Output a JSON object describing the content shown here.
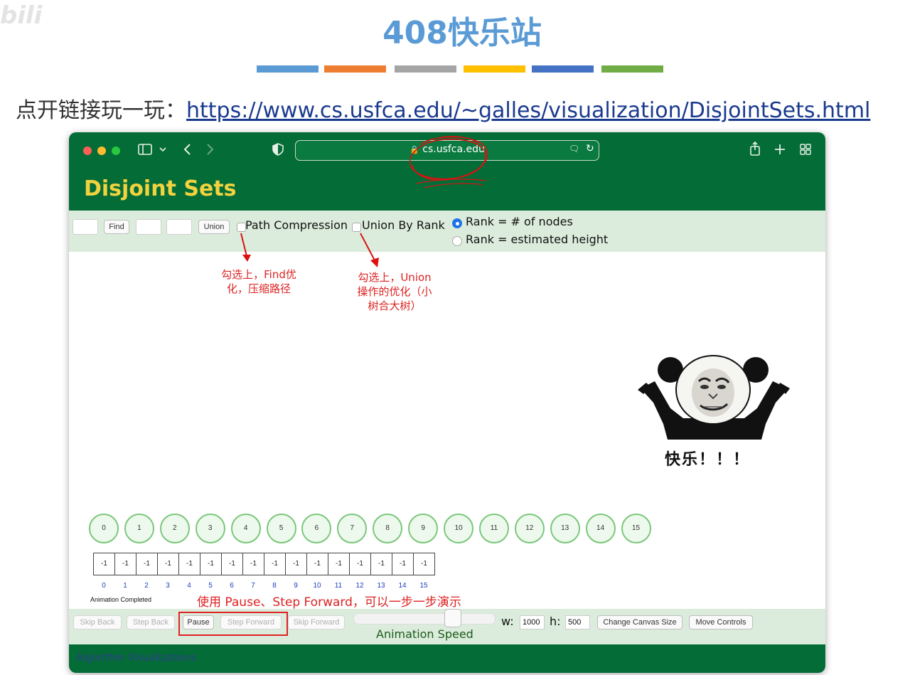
{
  "slide": {
    "title": "408快乐站",
    "strip_colors": [
      "#5b9bd5",
      "#ed7d31",
      "#a5a5a5",
      "#ffc000",
      "#4472c4",
      "#70ad47"
    ],
    "intro_label": "点开链接玩一玩：",
    "link_text": "https://www.cs.usfca.edu/~galles/visualization/DisjointSets.html",
    "watermark": "bili"
  },
  "browser": {
    "url": "cs.usfca.edu",
    "icons": [
      "sidebar-icon",
      "chevron-down-icon",
      "back-icon",
      "forward-icon",
      "shield-icon",
      "lock-icon",
      "translate-icon",
      "reload-icon",
      "share-icon",
      "new-tab-icon",
      "tab-overview-icon"
    ]
  },
  "page": {
    "title": "Disjoint Sets",
    "controls": {
      "find_label": "Find",
      "union_label": "Union",
      "path_compression_label": "Path Compression",
      "union_by_rank_label": "Union By Rank",
      "rank_nodes_label": "Rank = # of nodes",
      "rank_height_label": "Rank = estimated height",
      "selected_rank": "Rank = # of nodes"
    },
    "annotations": {
      "path_compression_line1": "勾选上，Find优",
      "path_compression_line2": "化，压缩路径",
      "union_rank_line1": "勾选上，Union",
      "union_rank_line2": "操作的优化（小",
      "union_rank_line3": "树合大树）",
      "bottom": "使用 Pause、Step Forward，可以一步一步演示"
    },
    "sticker_caption": "快乐！！！",
    "nodes": [
      "0",
      "1",
      "2",
      "3",
      "4",
      "5",
      "6",
      "7",
      "8",
      "9",
      "10",
      "11",
      "12",
      "13",
      "14",
      "15"
    ],
    "parent_array": [
      "-1",
      "-1",
      "-1",
      "-1",
      "-1",
      "-1",
      "-1",
      "-1",
      "-1",
      "-1",
      "-1",
      "-1",
      "-1",
      "-1",
      "-1",
      "-1"
    ],
    "array_indices": [
      "0",
      "1",
      "2",
      "3",
      "4",
      "5",
      "6",
      "7",
      "8",
      "9",
      "10",
      "11",
      "12",
      "13",
      "14",
      "15"
    ],
    "status": "Animation Completed",
    "bottom_controls": {
      "skip_back": "Skip Back",
      "step_back": "Step Back",
      "pause": "Pause",
      "step_forward": "Step Forward",
      "skip_forward": "Skip Forward",
      "speed_label": "Animation Speed",
      "speed_value": 0.7,
      "w_label": "w:",
      "w_value": "1000",
      "h_label": "h:",
      "h_value": "500",
      "change_canvas": "Change Canvas Size",
      "move_controls": "Move Controls"
    },
    "footer": "Algorithm Visualizations"
  }
}
